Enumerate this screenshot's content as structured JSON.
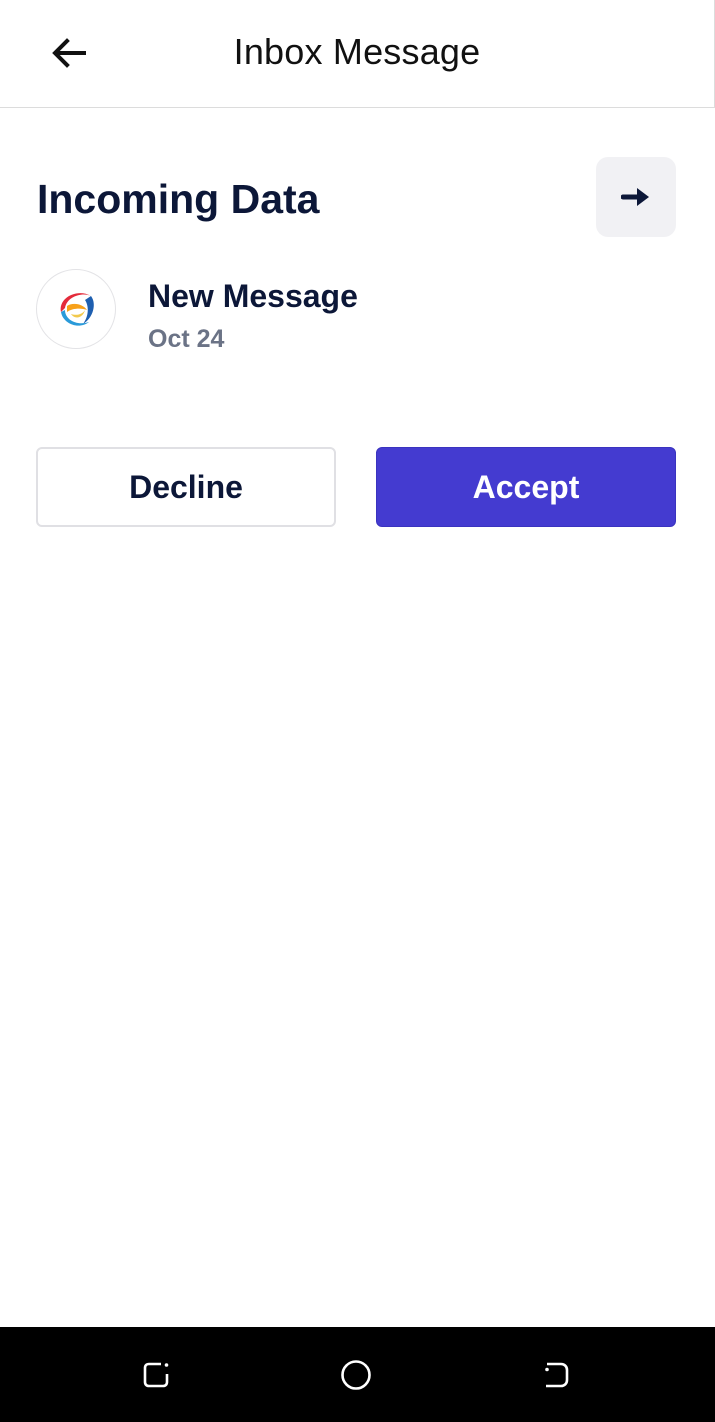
{
  "header": {
    "title": "Inbox Message",
    "back_icon": "arrow-left-icon"
  },
  "section": {
    "title": "Incoming Data",
    "action_icon": "arrow-right-icon"
  },
  "message": {
    "title": "New Message",
    "date": "Oct 24",
    "avatar_icon": "brand-logo-icon"
  },
  "actions": {
    "decline_label": "Decline",
    "accept_label": "Accept"
  },
  "colors": {
    "primary": "#443bd0",
    "text_dark": "#0c1738",
    "text_muted": "#6b7386",
    "icon_button_bg": "#f1f1f4",
    "nav_bar_bg": "#000000"
  },
  "system_nav": {
    "recents_icon": "recents-icon",
    "home_icon": "home-circle-icon",
    "back_icon": "system-back-icon"
  }
}
